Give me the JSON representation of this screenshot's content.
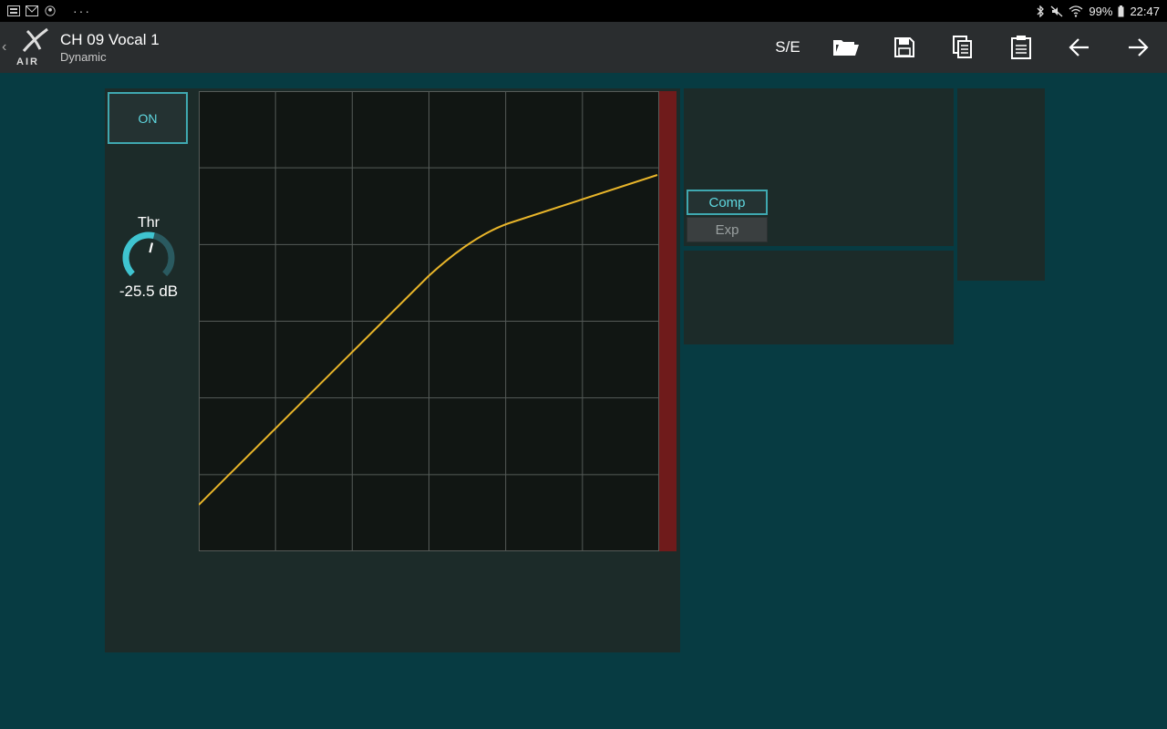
{
  "status_bar": {
    "battery": "99%",
    "time": "22:47",
    "icons": [
      "notification-icon",
      "gmail-icon",
      "account-icon",
      "bluetooth-icon",
      "mute-icon",
      "wifi-icon",
      "battery-icon"
    ]
  },
  "header": {
    "logo_text": "AIR",
    "title": "CH 09 Vocal 1",
    "subtitle": "Dynamic",
    "se_label": "S/E"
  },
  "dynamics": {
    "on_label": "ON",
    "threshold": {
      "label": "Thr",
      "value": "-25.5 dB",
      "level": 0.55
    },
    "mode": {
      "options": [
        "Comp",
        "Exp"
      ],
      "selected": "Comp"
    }
  },
  "colors": {
    "background": "#073b42",
    "panel": "#1c2b29",
    "accent": "#3fa8b0",
    "curve": "#e8b52a",
    "meter": "#6f1b1b"
  }
}
